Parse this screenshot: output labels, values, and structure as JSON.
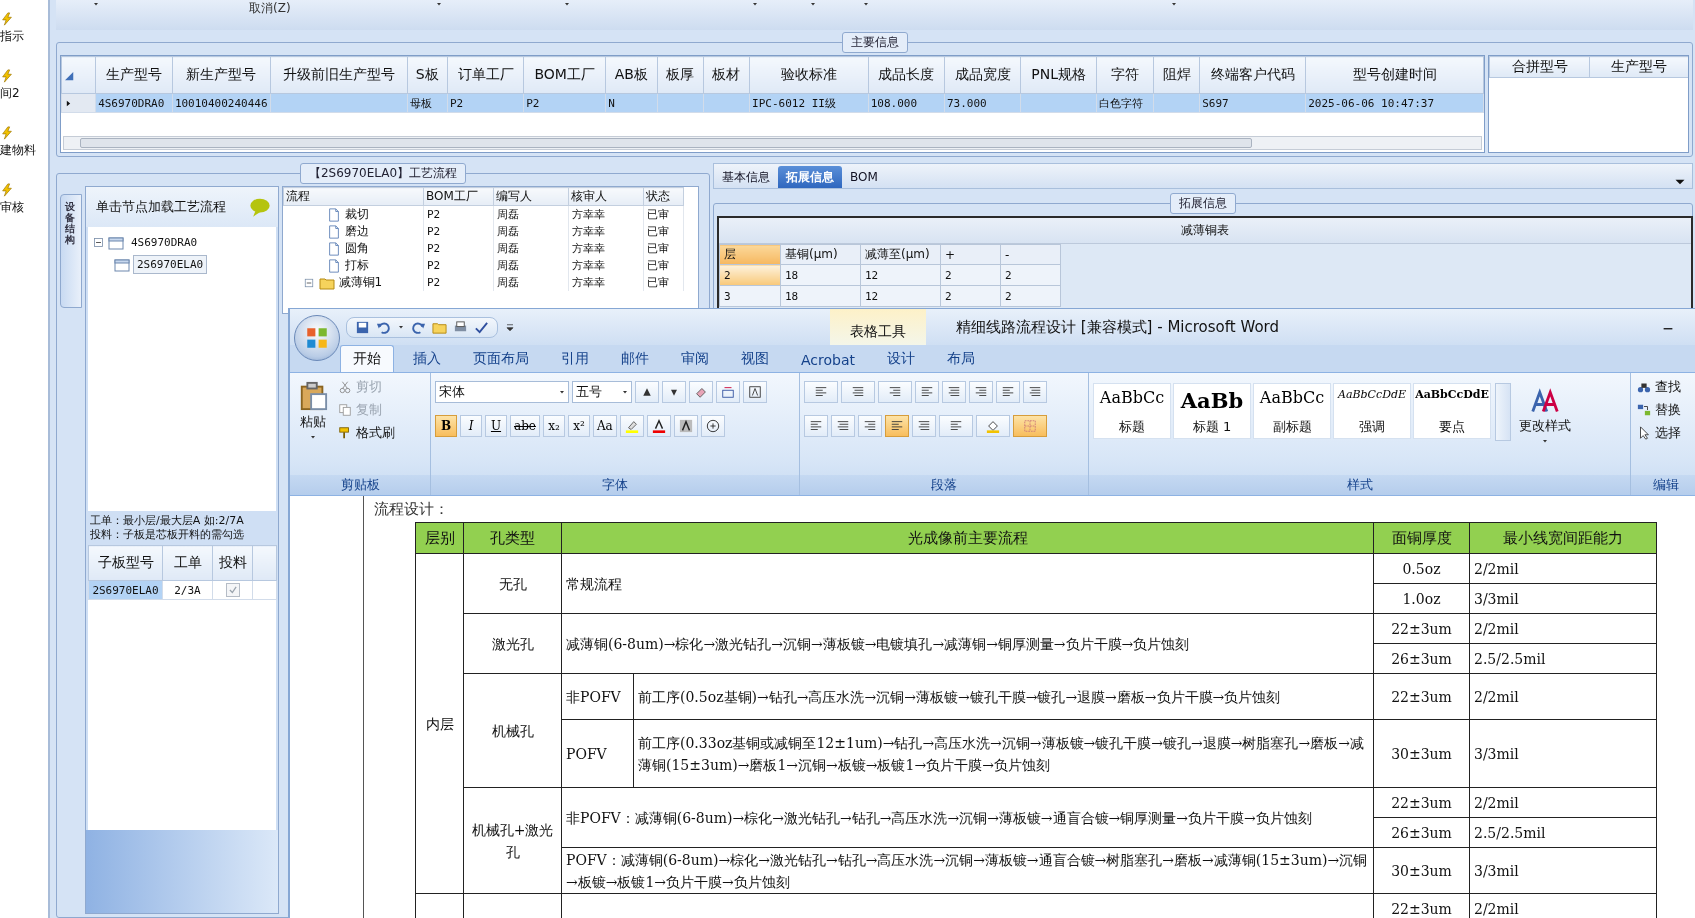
{
  "side_strip": {
    "items": [
      "指示",
      "间2",
      "建物料",
      "审核"
    ]
  },
  "toolbar": {
    "cancel": "取消(Z)"
  },
  "main_info": {
    "title": "主要信息",
    "columns": [
      "生产型号",
      "新生产型号",
      "升级前旧生产型号",
      "S板",
      "订单工厂",
      "BOM工厂",
      "AB板",
      "板厚",
      "板材",
      "验收标准",
      "成品长度",
      "成品宽度",
      "PNL规格",
      "字符",
      "阻焊",
      "终端客户代码",
      "型号创建时间"
    ],
    "rows": [
      {
        "selected": true,
        "cells": [
          "4S6970DRA0",
          "10010400240446",
          null,
          "母板",
          "P2",
          "P2",
          "N",
          null,
          null,
          "IPC-6012 II级",
          "108.000",
          "73.000",
          null,
          "白色字符",
          null,
          "S697",
          "2025-06-06 10:47:37"
        ]
      }
    ],
    "merge_columns": [
      "合拼型号",
      "生产型号"
    ]
  },
  "process": {
    "title": "【2S6970ELA0】工艺流程",
    "side_tab": "设备结构",
    "hint": "单击节点加载工艺流程",
    "tree": [
      {
        "label": "4S6970DRA0",
        "selected": false,
        "expanded": true,
        "children": [
          {
            "label": "2S6970ELA0",
            "selected": true
          }
        ]
      }
    ],
    "notes": [
      "工单：最小层/最大层A 如:2/7A",
      "投料：子板是芯板开料的需勾选"
    ],
    "sub_table": {
      "columns": [
        "子板型号",
        "工单",
        "投料"
      ],
      "rows": [
        {
          "cells": [
            "2S6970ELA0",
            "2/3A"
          ],
          "checked": true
        }
      ]
    },
    "flow_grid": {
      "columns": [
        "流程",
        "BOM工厂",
        "编写人",
        "核审人",
        "状态"
      ],
      "rows": [
        {
          "kind": "step",
          "cells": [
            "裁切",
            "P2",
            "周磊",
            "方幸幸",
            "已审"
          ]
        },
        {
          "kind": "step",
          "cells": [
            "磨边",
            "P2",
            "周磊",
            "方幸幸",
            "已审"
          ]
        },
        {
          "kind": "step",
          "cells": [
            "圆角",
            "P2",
            "周磊",
            "方幸幸",
            "已审"
          ]
        },
        {
          "kind": "step",
          "cells": [
            "打标",
            "P2",
            "周磊",
            "方幸幸",
            "已审"
          ]
        },
        {
          "kind": "group",
          "expanded": true,
          "cells": [
            "减薄铜1",
            "P2",
            "周磊",
            "方幸幸",
            "已审"
          ]
        }
      ]
    }
  },
  "detail": {
    "tabs": [
      {
        "label": "基本信息",
        "selected": false
      },
      {
        "label": "拓展信息",
        "selected": true
      },
      {
        "label": "BOM",
        "selected": false
      }
    ],
    "group_title": "拓展信息",
    "table": {
      "title": "减薄铜表",
      "columns": [
        "层",
        "基铜(μm)",
        "减薄至(μm)",
        "+",
        "-"
      ],
      "rows": [
        {
          "selected": true,
          "cells": [
            "2",
            "18",
            "12",
            "2",
            "2"
          ]
        },
        {
          "selected": false,
          "cells": [
            "3",
            "18",
            "12",
            "2",
            "2"
          ]
        }
      ]
    }
  },
  "word": {
    "context_tab": "表格工具",
    "title": "精细线路流程设计 [兼容模式] - Microsoft Word",
    "tabs": [
      {
        "label": "开始",
        "selected": true
      },
      {
        "label": "插入",
        "selected": false
      },
      {
        "label": "页面布局",
        "selected": false
      },
      {
        "label": "引用",
        "selected": false
      },
      {
        "label": "邮件",
        "selected": false
      },
      {
        "label": "审阅",
        "selected": false
      },
      {
        "label": "视图",
        "selected": false
      },
      {
        "label": "Acrobat",
        "selected": false
      },
      {
        "label": "设计",
        "selected": false
      },
      {
        "label": "布局",
        "selected": false
      }
    ],
    "clipboard": {
      "label": "剪贴板",
      "paste": "粘贴",
      "actions": [
        {
          "label": "剪切",
          "disabled": true
        },
        {
          "label": "复制",
          "disabled": true
        },
        {
          "label": "格式刷",
          "disabled": false
        }
      ]
    },
    "font": {
      "label": "字体",
      "name": "宋体",
      "size": "五号",
      "format_buttons": [
        {
          "label": "B",
          "on": true
        },
        {
          "label": "I",
          "on": false
        },
        {
          "label": "U",
          "on": false
        },
        {
          "label": "abe",
          "on": false
        },
        {
          "label": "x₂",
          "on": false
        },
        {
          "label": "x²",
          "on": false
        },
        {
          "label": "Aa",
          "on": false
        }
      ]
    },
    "paragraph": {
      "label": "段落",
      "align_buttons": [
        {
          "on": false
        },
        {
          "on": false
        },
        {
          "on": false
        },
        {
          "on": true
        },
        {
          "on": false
        }
      ]
    },
    "styles": {
      "label": "样式",
      "change": "更改样式",
      "items": [
        {
          "kind": "title",
          "sample": "AaBbCc",
          "name": "标题"
        },
        {
          "kind": "heading",
          "sample": "AaBb",
          "name": "标题 1"
        },
        {
          "kind": "subtitle",
          "sample": "AaBbCc",
          "name": "副标题"
        },
        {
          "kind": "emphasis",
          "sample": "AaBbCcDdE",
          "name": "强调"
        },
        {
          "kind": "strong",
          "sample": "AaBbCcDdE",
          "name": "要点"
        }
      ]
    },
    "editing": {
      "label": "编辑",
      "items": [
        {
          "kind": "find",
          "label": "查找"
        },
        {
          "kind": "replace",
          "label": "替换"
        },
        {
          "kind": "select",
          "label": "选择"
        }
      ]
    },
    "document": {
      "heading": "流程设计：",
      "table": {
        "columns": [
          "层别",
          "孔类型",
          "光成像前主要流程",
          "面铜厚度",
          "最小线宽间距能力"
        ],
        "layer": "内层",
        "groups": [
          {
            "hole": "无孔",
            "flows": [
              {
                "text": "常规流程",
                "specs": [
                  [
                    "0.5oz",
                    "2/2mil"
                  ],
                  [
                    "1.0oz",
                    "3/3mil"
                  ]
                ]
              }
            ]
          },
          {
            "hole": "激光孔",
            "flows": [
              {
                "text": "减薄铜(6-8um)→棕化→激光钻孔→沉铜→薄板镀→电镀填孔→减薄铜→铜厚测量→负片干膜→负片蚀刻",
                "specs": [
                  [
                    "22±3um",
                    "2/2mil"
                  ],
                  [
                    "26±3um",
                    "2.5/2.5mil"
                  ]
                ]
              }
            ]
          },
          {
            "hole": "机械孔",
            "flows": [
              {
                "label": "非POFV",
                "text": "前工序(0.5oz基铜)→钻孔→高压水洗→沉铜→薄板镀→镀孔干膜→镀孔→退膜→磨板→负片干膜→负片蚀刻",
                "specs": [
                  [
                    "22±3um",
                    "2/2mil"
                  ]
                ]
              },
              {
                "label": "POFV",
                "text": "前工序(0.33oz基铜或减铜至12±1um)→钻孔→高压水洗→沉铜→薄板镀→镀孔干膜→镀孔→退膜→树脂塞孔→磨板→减薄铜(15±3um)→磨板1→沉铜→板镀→板镀1→负片干膜→负片蚀刻",
                "specs": [
                  [
                    "30±3um",
                    "3/3mil"
                  ]
                ]
              }
            ]
          },
          {
            "hole": "机械孔+激光孔",
            "flows": [
              {
                "text": "非POFV：减薄铜(6-8um)→棕化→激光钻孔→钻孔→高压水洗→沉铜→薄板镀→通盲合镀→铜厚测量→负片干膜→负片蚀刻",
                "specs": [
                  [
                    "22±3um",
                    "2/2mil"
                  ],
                  [
                    "26±3um",
                    "2.5/2.5mil"
                  ]
                ]
              },
              {
                "text": "POFV：减薄铜(6-8um)→棕化→激光钻孔→钻孔→高压水洗→沉铜→薄板镀→通盲合镀→树脂塞孔→磨板→减薄铜(15±3um)→沉铜→板镀→板镀1→负片干膜→负片蚀刻",
                "specs": [
                  [
                    "30±3um",
                    "3/3mil"
                  ]
                ]
              }
            ]
          }
        ],
        "partial_specs": [
          [
            "22±3um",
            "2/2mil"
          ]
        ]
      }
    }
  }
}
